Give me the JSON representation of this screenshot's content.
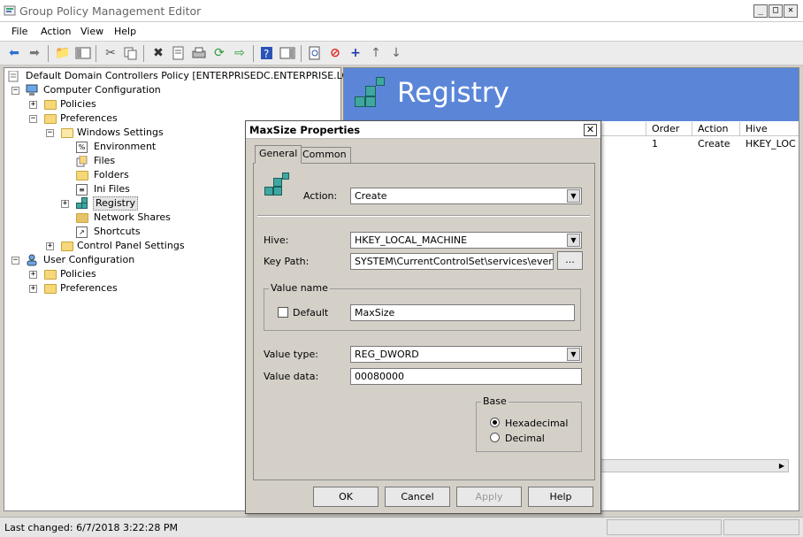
{
  "window": {
    "title": "Group Policy Management Editor",
    "controls": [
      "_",
      "□",
      "✕"
    ]
  },
  "menu": [
    "File",
    "Action",
    "View",
    "Help"
  ],
  "tree": {
    "root": "Default Domain Controllers Policy [ENTERPRISEDC.ENTERPRISE.LOCAL] P",
    "computer_config": "Computer Configuration",
    "policies": "Policies",
    "preferences": "Preferences",
    "windows_settings": "Windows Settings",
    "environment": "Environment",
    "files": "Files",
    "folders": "Folders",
    "ini_files": "Ini Files",
    "registry": "Registry",
    "network_shares": "Network Shares",
    "shortcuts": "Shortcuts",
    "control_panel": "Control Panel Settings",
    "user_config": "User Configuration",
    "user_policies": "Policies",
    "user_preferences": "Preferences"
  },
  "right": {
    "banner": "Registry",
    "columns": [
      "Order",
      "Action",
      "Hive"
    ],
    "row": [
      "1",
      "Create",
      "HKEY_LOC"
    ]
  },
  "status": {
    "text": "Last changed: 6/7/2018 3:22:28 PM"
  },
  "dialog": {
    "title": "MaxSize Properties",
    "close": "✕",
    "tabs": [
      "General",
      "Common"
    ],
    "action_label": "Action:",
    "action_value": "Create",
    "hive_label": "Hive:",
    "hive_value": "HKEY_LOCAL_MACHINE",
    "keypath_label": "Key Path:",
    "keypath_value": "SYSTEM\\CurrentControlSet\\services\\eventlog\\",
    "browse": "...",
    "value_name_group": "Value name",
    "default_label": "Default",
    "value_name": "MaxSize",
    "value_type_label": "Value type:",
    "value_type": "REG_DWORD",
    "value_data_label": "Value data:",
    "value_data": "00080000",
    "base_group": "Base",
    "hex_label": "Hexadecimal",
    "dec_label": "Decimal",
    "buttons": {
      "ok": "OK",
      "cancel": "Cancel",
      "apply": "Apply",
      "help": "Help"
    }
  }
}
